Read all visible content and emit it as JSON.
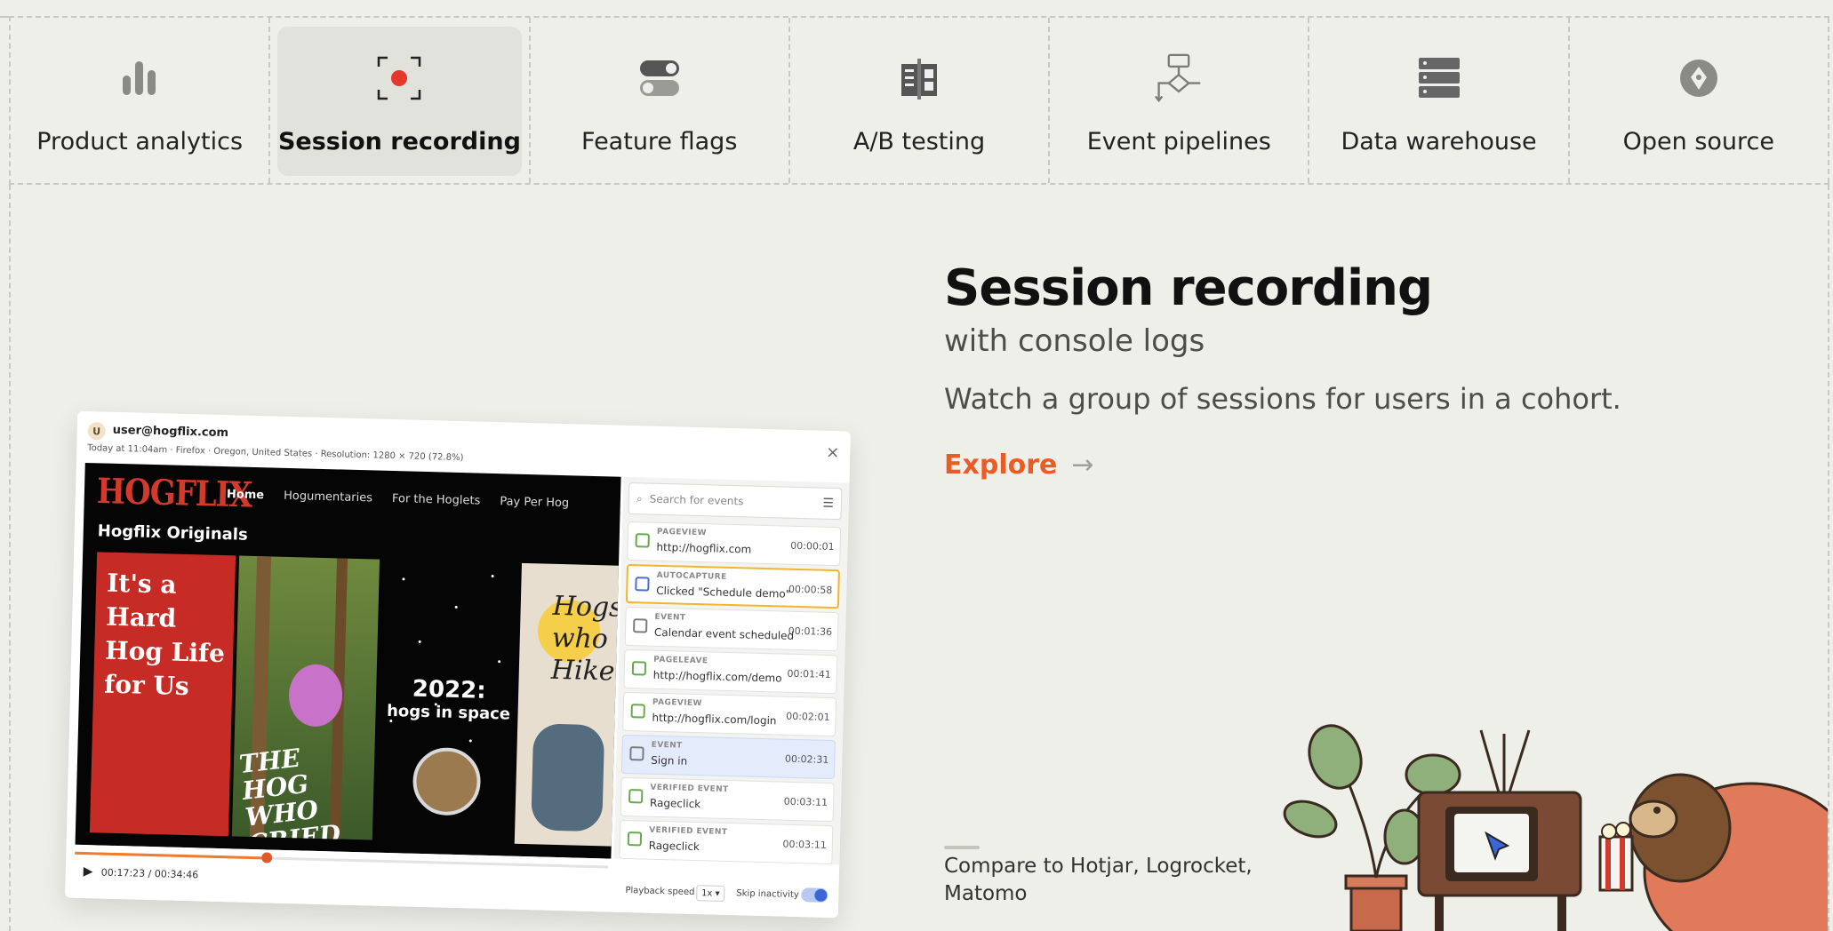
{
  "tabs": [
    {
      "label": "Product analytics",
      "icon": "bar-chart-icon",
      "active": false
    },
    {
      "label": "Session recording",
      "icon": "record-icon",
      "active": true
    },
    {
      "label": "Feature flags",
      "icon": "toggle-icon",
      "active": false
    },
    {
      "label": "A/B testing",
      "icon": "split-test-icon",
      "active": false
    },
    {
      "label": "Event pipelines",
      "icon": "pipeline-icon",
      "active": false
    },
    {
      "label": "Data warehouse",
      "icon": "database-icon",
      "active": false
    },
    {
      "label": "Open source",
      "icon": "pen-nib-icon",
      "active": false
    }
  ],
  "hero": {
    "title": "Session recording",
    "subtitle": "with console logs",
    "description": "Watch a group of sessions for users in a cohort.",
    "cta": "Explore",
    "cta_arrow": "→",
    "compare": "Compare to Hotjar, Logrocket, Matomo"
  },
  "player": {
    "avatar_letter": "U",
    "user": "user@hogflix.com",
    "meta": "Today at 11:04am · Firefox · Oregon, United States · Resolution: 1280 × 720 (72.8%)",
    "close": "×",
    "app": {
      "logo": "HOGFLIX",
      "nav": [
        "Home",
        "Hogumentaries",
        "For the Hoglets",
        "Pay Per Hog"
      ],
      "section": "Hogflix Originals",
      "posters": [
        "It's a Hard Hog Life for Us",
        "THE HOG WHO CRIED WOLF",
        "2022:",
        "hogs in space",
        "Hogs who Hike"
      ]
    },
    "search_placeholder": "Search for events",
    "events": [
      {
        "type": "PAGEVIEW",
        "value": "http://hogflix.com",
        "time": "00:00:01"
      },
      {
        "type": "AUTOCAPTURE",
        "value": "Clicked \"Schedule demo\"",
        "time": "00:00:58"
      },
      {
        "type": "EVENT",
        "value": "Calendar event scheduled",
        "time": "00:01:36"
      },
      {
        "type": "PAGELEAVE",
        "value": "http://hogflix.com/demo",
        "time": "00:01:41"
      },
      {
        "type": "PAGEVIEW",
        "value": "http://hogflix.com/login",
        "time": "00:02:01"
      },
      {
        "type": "EVENT",
        "value": "Sign in",
        "time": "00:02:31"
      },
      {
        "type": "VERIFIED EVENT",
        "value": "Rageclick",
        "time": "00:03:11"
      },
      {
        "type": "VERIFIED EVENT",
        "value": "Rageclick",
        "time": "00:03:11"
      }
    ],
    "progress": 0.36,
    "timecode": "00:17:23 / 00:34:46",
    "playback_label": "Playback speed",
    "playback_value": "1x ▾",
    "skip_label": "Skip inactivity",
    "skip_on": true
  },
  "colors": {
    "accent": "#eb5c24",
    "background": "#eeefe9",
    "record_dot": "#e5372b"
  }
}
